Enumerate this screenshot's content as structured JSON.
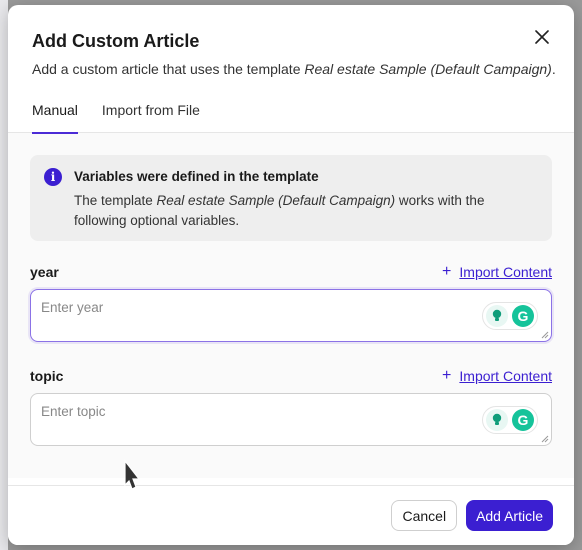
{
  "modal": {
    "title": "Add Custom Article",
    "subtitle_prefix": "Add a custom article that uses the template ",
    "subtitle_template": "Real estate Sample (Default Campaign)",
    "subtitle_suffix": "."
  },
  "tabs": [
    {
      "label": "Manual",
      "active": true
    },
    {
      "label": "Import from File",
      "active": false
    }
  ],
  "info": {
    "icon": "info-icon",
    "title": "Variables were defined in the template",
    "text_prefix": "The template ",
    "text_template": "Real estate Sample (Default Campaign)",
    "text_suffix": " works with the following optional variables."
  },
  "fields": [
    {
      "label": "year",
      "placeholder": "Enter year",
      "import_label": "Import Content",
      "focused": true
    },
    {
      "label": "topic",
      "placeholder": "Enter topic",
      "import_label": "Import Content",
      "focused": false
    }
  ],
  "footer": {
    "cancel_label": "Cancel",
    "submit_label": "Add Article"
  },
  "colors": {
    "accent": "#3b1fd1",
    "focus_border": "#8b72e6",
    "grammarly": "#15c39a"
  }
}
